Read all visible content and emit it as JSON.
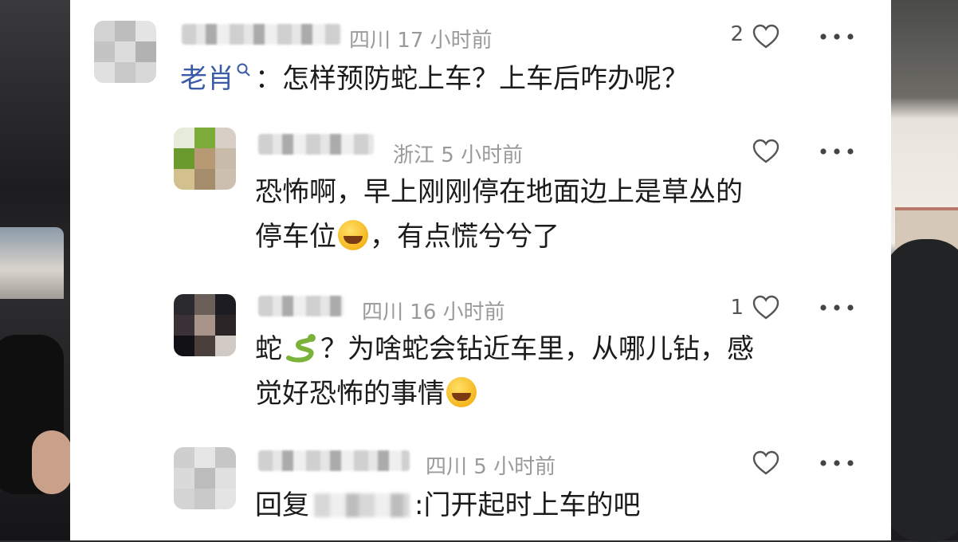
{
  "comments": [
    {
      "location": "四川",
      "time": "17 小时前",
      "likes": "2",
      "author": "老肖",
      "text": "：怎样预防蛇上车？上车后咋办呢？"
    },
    {
      "location": "浙江",
      "time": "5 小时前",
      "likes": "",
      "text_line1": "恐怖啊，早上刚刚停在地面边上是草丛的",
      "text_line2_a": "停车位",
      "text_line2_b": "，有点慌兮兮了"
    },
    {
      "location": "四川",
      "time": "16 小时前",
      "likes": "1",
      "text_line1_a": "蛇",
      "text_line1_b": "？为啥蛇会钻近车里，从哪儿钻，感",
      "text_line2_a": "觉好恐怖的事情"
    },
    {
      "location": "四川",
      "time": "5 小时前",
      "likes": "",
      "reply_prefix": "回复",
      "reply_text": ":门开起时上车的吧"
    }
  ],
  "icons": {
    "heart": "heart-icon",
    "more": "more-icon",
    "search": "search-icon",
    "emoji": "laughing-crying-emoji",
    "snake": "snake-emoji"
  },
  "colors": {
    "author": "#3b5aa8",
    "meta": "#9a9a9a",
    "text": "#1b1b1b"
  }
}
